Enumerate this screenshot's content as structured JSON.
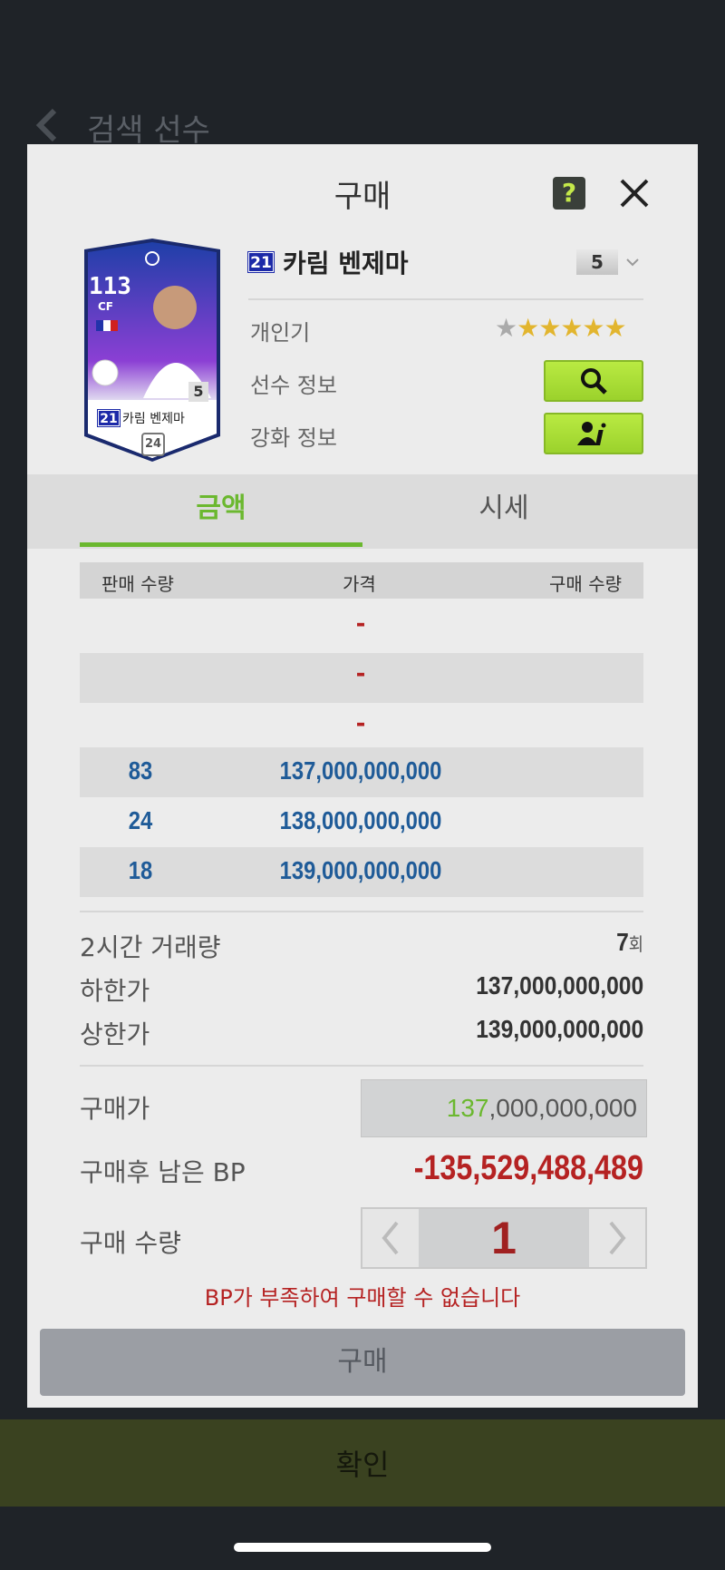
{
  "background": {
    "title": "검색 선수",
    "confirm_label": "확인"
  },
  "modal": {
    "title": "구매",
    "help_label": "?"
  },
  "card": {
    "ovr": "113",
    "position": "CF",
    "level": "5",
    "season": "21",
    "name": "카림 벤제마",
    "card_season_mark": "24"
  },
  "player": {
    "season": "21",
    "name": "카림 벤제마",
    "level": "5",
    "popularity_label": "개인기",
    "popularity_stars": 5,
    "popularity_max": 6,
    "info_label": "선수 정보",
    "upgrade_label": "강화 정보"
  },
  "tabs": [
    {
      "label": "금액",
      "active": true
    },
    {
      "label": "시세",
      "active": false
    }
  ],
  "orders": {
    "headers": [
      "판매 수량",
      "가격",
      "구매 수량"
    ],
    "rows": [
      {
        "qty": "",
        "price": "-"
      },
      {
        "qty": "",
        "price": "-"
      },
      {
        "qty": "",
        "price": "-"
      },
      {
        "qty": "83",
        "price": "137,000,000,000"
      },
      {
        "qty": "24",
        "price": "138,000,000,000"
      },
      {
        "qty": "18",
        "price": "139,000,000,000"
      }
    ]
  },
  "stats": {
    "volume_label": "2시간 거래량",
    "volume_value": "7",
    "volume_unit": "회",
    "low_label": "하한가",
    "low_value": "137,000,000,000",
    "high_label": "상한가",
    "high_value": "139,000,000,000"
  },
  "purchase": {
    "price_label": "구매가",
    "price_highlight": "137",
    "price_rest": ",000,000,000",
    "remain_label": "구매후 남은 BP",
    "remain_value": "-135,529,488,489",
    "qty_label": "구매 수량",
    "qty_value": "1",
    "warning": "BP가 부족하여 구매할 수 없습니다",
    "buy_label": "구매"
  },
  "colors": {
    "accent_green": "#6bb82f",
    "price_blue": "#1f5b98",
    "error_red": "#b52222"
  }
}
